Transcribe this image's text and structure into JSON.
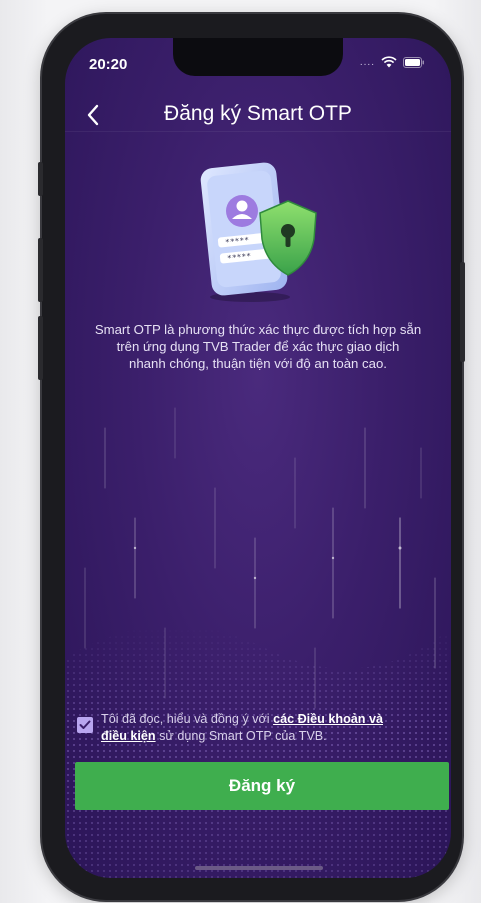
{
  "status_bar": {
    "time": "20:20",
    "signal": "....",
    "icons": [
      "wifi-icon",
      "battery-icon"
    ]
  },
  "header": {
    "back_icon": "chevron-left-icon",
    "title": "Đăng ký Smart OTP"
  },
  "illustration": {
    "icon": "phone-shield-illustration",
    "password_mask_1": "*****",
    "password_mask_2": "*****"
  },
  "description": {
    "line1": "Smart OTP là phương thức xác thực được tích hợp sẵn",
    "line2": "trên ứng dụng TVB Trader để xác thực giao dịch",
    "line3": "nhanh chóng, thuận tiện với độ an toàn cao."
  },
  "terms": {
    "checked": true,
    "prefix": "Tôi đã đọc, hiểu và đồng ý với ",
    "link_line1": "các Điều khoản và",
    "link_line2": "điều kiện",
    "suffix": " sử dụng Smart OTP của TVB."
  },
  "register_button": {
    "label": "Đăng ký"
  },
  "colors": {
    "background_top": "#4a2a7d",
    "background_bottom": "#2b1558",
    "accent_green": "#3fae4e",
    "checkbox": "#b9a6f0"
  }
}
